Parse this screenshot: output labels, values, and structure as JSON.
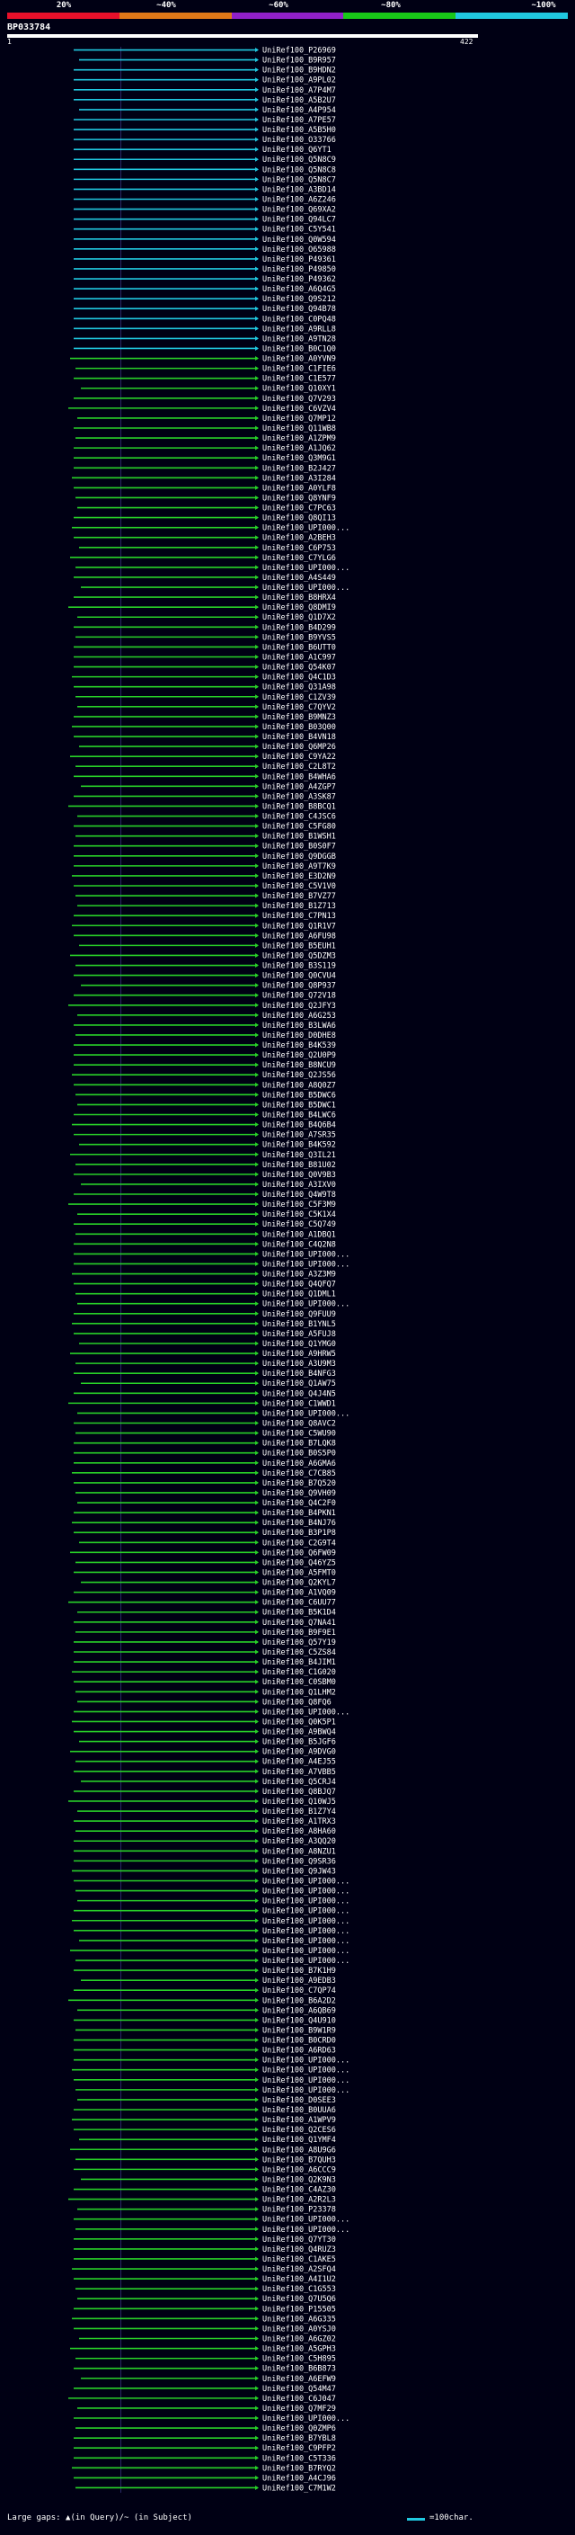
{
  "header": {
    "pct_labels": [
      "20%",
      "~40%",
      "~60%",
      "~80%",
      "~100%"
    ],
    "color_bar": [
      "#e8102a",
      "#e07818",
      "#9020c8",
      "#18c818",
      "#20c8e0"
    ],
    "query_title": "BP033784",
    "query_start": "1",
    "query_end": "422"
  },
  "colors": {
    "cyan": "#20c8e0",
    "green": "#28d028"
  },
  "legend": {
    "large_gaps": "Large gaps: ▲(in Query)/~ (in Subject)",
    "scale": "=100char."
  },
  "hits": [
    "UniRef100_P26969",
    "UniRef100_B9R957",
    "UniRef100_B9HDN2",
    "UniRef100_A9PL02",
    "UniRef100_A7P4M7",
    "UniRef100_A5B2U7",
    "UniRef100_A4P954",
    "UniRef100_A7PE57",
    "UniRef100_A5B5H0",
    "UniRef100_O33766",
    "UniRef100_Q6YT1",
    "UniRef100_Q5N8C9",
    "UniRef100_Q5N8C8",
    "UniRef100_Q5N8C7",
    "UniRef100_A3BD14",
    "UniRef100_A6Z246",
    "UniRef100_Q69XA2",
    "UniRef100_Q94LC7",
    "UniRef100_C5Y541",
    "UniRef100_Q0W594",
    "UniRef100_O65988",
    "UniRef100_P49361",
    "UniRef100_P49850",
    "UniRef100_P49362",
    "UniRef100_A6Q4G5",
    "UniRef100_Q9S212",
    "UniRef100_Q94B78",
    "UniRef100_C0PQ48",
    "UniRef100_A9RLL8",
    "UniRef100_A9TN28",
    "UniRef100_B0C1Q0",
    "UniRef100_A0YVN9",
    "UniRef100_C1FIE6",
    "UniRef100_C1E577",
    "UniRef100_Q10XY1",
    "UniRef100_Q7V293",
    "UniRef100_C6VZV4",
    "UniRef100_Q7MP12",
    "UniRef100_Q11WB8",
    "UniRef100_A1ZPM9",
    "UniRef100_A1JQ62",
    "UniRef100_Q3M9G1",
    "UniRef100_B2J427",
    "UniRef100_A3I284",
    "UniRef100_A0YLF8",
    "UniRef100_Q8YNF9",
    "UniRef100_C7PC63",
    "UniRef100_Q8QI13",
    "UniRef100_UPI000...",
    "UniRef100_A2BEH3",
    "UniRef100_C6P753",
    "UniRef100_C7YLG6",
    "UniRef100_UPI000...",
    "UniRef100_A4S449",
    "UniRef100_UPI000...",
    "UniRef100_B8HRX4",
    "UniRef100_Q8DMI9",
    "UniRef100_Q1D7X2",
    "UniRef100_B4D299",
    "UniRef100_B9YVS5",
    "UniRef100_B6UTT0",
    "UniRef100_A1C997",
    "UniRef100_Q54K07",
    "UniRef100_Q4C1D3",
    "UniRef100_Q31A98",
    "UniRef100_C1ZV39",
    "UniRef100_C7QYV2",
    "UniRef100_B9MNZ3",
    "UniRef100_B03Q00",
    "UniRef100_B4VN18",
    "UniRef100_Q6MP26",
    "UniRef100_C9YA22",
    "UniRef100_C2L8T2",
    "UniRef100_B4WHA6",
    "UniRef100_A4ZGP7",
    "UniRef100_A3SK87",
    "UniRef100_B8BCQ1",
    "UniRef100_C4JSC6",
    "UniRef100_C5FG80",
    "UniRef100_B1WSH1",
    "UniRef100_B0S0F7",
    "UniRef100_Q9DGGB",
    "UniRef100_A9T7K9",
    "UniRef100_E3D2N9",
    "UniRef100_C5V1V0",
    "UniRef100_B7VZ77",
    "UniRef100_B1Z713",
    "UniRef100_C7PN13",
    "UniRef100_Q1R1V7",
    "UniRef100_A6FU98",
    "UniRef100_B5EUH1",
    "UniRef100_Q5DZM3",
    "UniRef100_B3S119",
    "UniRef100_Q0CVU4",
    "UniRef100_Q8P937",
    "UniRef100_Q72V18",
    "UniRef100_Q2JFY3",
    "UniRef100_A6G253",
    "UniRef100_B3LWA6",
    "UniRef100_D0DHE8",
    "UniRef100_B4K539",
    "UniRef100_Q2U0P9",
    "UniRef100_B8NCU9",
    "UniRef100_Q2JS56",
    "UniRef100_A8Q0Z7",
    "UniRef100_B5DWC6",
    "UniRef100_B5DWC1",
    "UniRef100_B4LWC6",
    "UniRef100_B4Q6B4",
    "UniRef100_A7SR35",
    "UniRef100_B4K592",
    "UniRef100_Q3IL21",
    "UniRef100_B81U02",
    "UniRef100_Q0V9B3",
    "UniRef100_A3IXV0",
    "UniRef100_Q4W9T8",
    "UniRef100_C5F3M9",
    "UniRef100_C5K1X4",
    "UniRef100_C5Q749",
    "UniRef100_A1DBQ1",
    "UniRef100_C4Q2N8",
    "UniRef100_UPI000...",
    "UniRef100_UPI000...",
    "UniRef100_A3Z3M9",
    "UniRef100_Q4QFQ7",
    "UniRef100_Q1DML1",
    "UniRef100_UPI000...",
    "UniRef100_Q9FUU9",
    "UniRef100_B1YNL5",
    "UniRef100_A5FUJ8",
    "UniRef100_Q1YMG0",
    "UniRef100_A9HRW5",
    "UniRef100_A3U9M3",
    "UniRef100_B4NFG3",
    "UniRef100_Q1AW75",
    "UniRef100_Q4J4N5",
    "UniRef100_C1WWD1",
    "UniRef100_UPI000...",
    "UniRef100_Q8AVC2",
    "UniRef100_C5WU90",
    "UniRef100_B7LQK8",
    "UniRef100_B0S5P0",
    "UniRef100_A6GMA6",
    "UniRef100_C7CB85",
    "UniRef100_B7Q520",
    "UniRef100_Q9VH09",
    "UniRef100_Q4C2F0",
    "UniRef100_B4PKN1",
    "UniRef100_B4NJ76",
    "UniRef100_B3P1P8",
    "UniRef100_C2G9T4",
    "UniRef100_Q6FW09",
    "UniRef100_Q46YZ5",
    "UniRef100_A5FMT0",
    "UniRef100_Q2KYL7",
    "UniRef100_A1VQ09",
    "UniRef100_C6UU77",
    "UniRef100_B5K1D4",
    "UniRef100_Q7NA41",
    "UniRef100_B9F9E1",
    "UniRef100_Q57Y19",
    "UniRef100_C5ZS84",
    "UniRef100_B4JIM1",
    "UniRef100_C1G020",
    "UniRef100_C0SBM0",
    "UniRef100_Q1LHM2",
    "UniRef100_Q8FQ6",
    "UniRef100_UPI000...",
    "UniRef100_Q0K5P1",
    "UniRef100_A9BWQ4",
    "UniRef100_B5JGF6",
    "UniRef100_A9DVG0",
    "UniRef100_A4EJ55",
    "UniRef100_A7VBB5",
    "UniRef100_Q5CRJ4",
    "UniRef100_Q8BJQ7",
    "UniRef100_Q10WJ5",
    "UniRef100_B1Z7Y4",
    "UniRef100_A1TRX3",
    "UniRef100_A8HA60",
    "UniRef100_A3QQ20",
    "UniRef100_A8NZU1",
    "UniRef100_Q9SR36",
    "UniRef100_Q9JW43",
    "UniRef100_UPI000...",
    "UniRef100_UPI000...",
    "UniRef100_UPI000...",
    "UniRef100_UPI000...",
    "UniRef100_UPI000...",
    "UniRef100_UPI000...",
    "UniRef100_UPI000...",
    "UniRef100_UPI000...",
    "UniRef100_UPI000...",
    "UniRef100_B7K1H9",
    "UniRef100_A9EDB3",
    "UniRef100_C7QP74",
    "UniRef100_B6A2D2",
    "UniRef100_A6QB69",
    "UniRef100_Q4U910",
    "UniRef100_B9W1R9",
    "UniRef100_B0CRD0",
    "UniRef100_A6RD63",
    "UniRef100_UPI000...",
    "UniRef100_UPI000...",
    "UniRef100_UPI000...",
    "UniRef100_UPI000...",
    "UniRef100_D0SEE3",
    "UniRef100_B0UUA6",
    "UniRef100_A1WPV9",
    "UniRef100_Q2CES6",
    "UniRef100_Q1YMF4",
    "UniRef100_A8U9G6",
    "UniRef100_B7QUH3",
    "UniRef100_A6CCC9",
    "UniRef100_Q2K9N3",
    "UniRef100_C4AZ30",
    "UniRef100_A2R2L3",
    "UniRef100_P23378",
    "UniRef100_UPI000...",
    "UniRef100_UPI000...",
    "UniRef100_Q7YT30",
    "UniRef100_Q4RUZ3",
    "UniRef100_C1AKE5",
    "UniRef100_A2SFQ4",
    "UniRef100_A4I1U2",
    "UniRef100_C1G553",
    "UniRef100_Q7U5Q6",
    "UniRef100_P15505",
    "UniRef100_A6G335",
    "UniRef100_A0YSJ0",
    "UniRef100_A6GZ02",
    "UniRef100_A5GPH3",
    "UniRef100_C5H895",
    "UniRef100_B6B873",
    "UniRef100_A6EFW9",
    "UniRef100_Q54M47",
    "UniRef100_C6J047",
    "UniRef100_Q7MF29",
    "UniRef100_UPI000...",
    "UniRef100_Q0ZMP6",
    "UniRef100_B7YBL8",
    "UniRef100_C9PFP2",
    "UniRef100_C5T336",
    "UniRef100_B7RYQ2",
    "UniRef100_A4CJ96",
    "UniRef100_C7M1W2"
  ]
}
